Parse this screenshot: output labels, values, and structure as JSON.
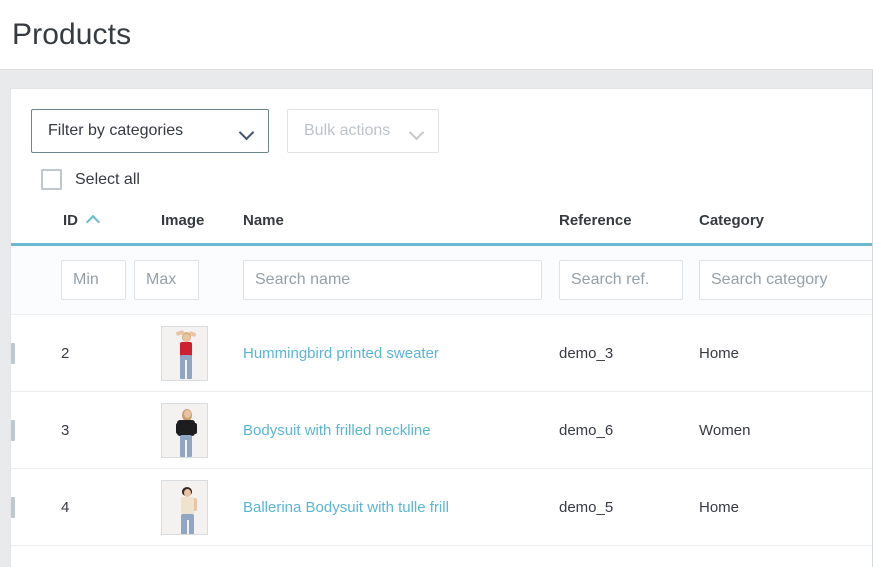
{
  "header": {
    "title": "Products"
  },
  "toolbar": {
    "filter_categories_label": "Filter by categories",
    "filter_categories_icon": "chevron-down-icon",
    "bulk_actions_label": "Bulk actions",
    "bulk_actions_icon": "chevron-down-icon",
    "bulk_actions_disabled": true
  },
  "select_all": {
    "label": "Select all",
    "checked": false
  },
  "table": {
    "columns": {
      "id": "ID",
      "image": "Image",
      "name": "Name",
      "reference": "Reference",
      "category": "Category"
    },
    "sort": {
      "column": "ID",
      "direction": "asc",
      "icon": "caret-up-icon"
    },
    "filters": {
      "id_min_placeholder": "Min",
      "id_min_value": "",
      "id_max_placeholder": "Max",
      "id_max_value": "",
      "name_placeholder": "Search name",
      "name_value": "",
      "reference_placeholder": "Search ref.",
      "reference_value": "",
      "category_placeholder": "Search category",
      "category_value": ""
    },
    "rows": [
      {
        "id": "2",
        "name": "Hummingbird printed sweater",
        "reference": "demo_3",
        "category": "Home",
        "image_alt": "woman-in-red-top-and-jeans",
        "checked": false
      },
      {
        "id": "3",
        "name": "Bodysuit with frilled neckline",
        "reference": "demo_6",
        "category": "Women",
        "image_alt": "woman-in-black-off-shoulder-top",
        "checked": false
      },
      {
        "id": "4",
        "name": "Ballerina Bodysuit with tulle frill",
        "reference": "demo_5",
        "category": "Home",
        "image_alt": "woman-in-cream-bodysuit",
        "checked": false
      }
    ]
  },
  "colors": {
    "accent": "#6bb9d1",
    "link": "#5ab6d4",
    "text": "#363a41",
    "workspace_bg": "#e9eaec"
  }
}
